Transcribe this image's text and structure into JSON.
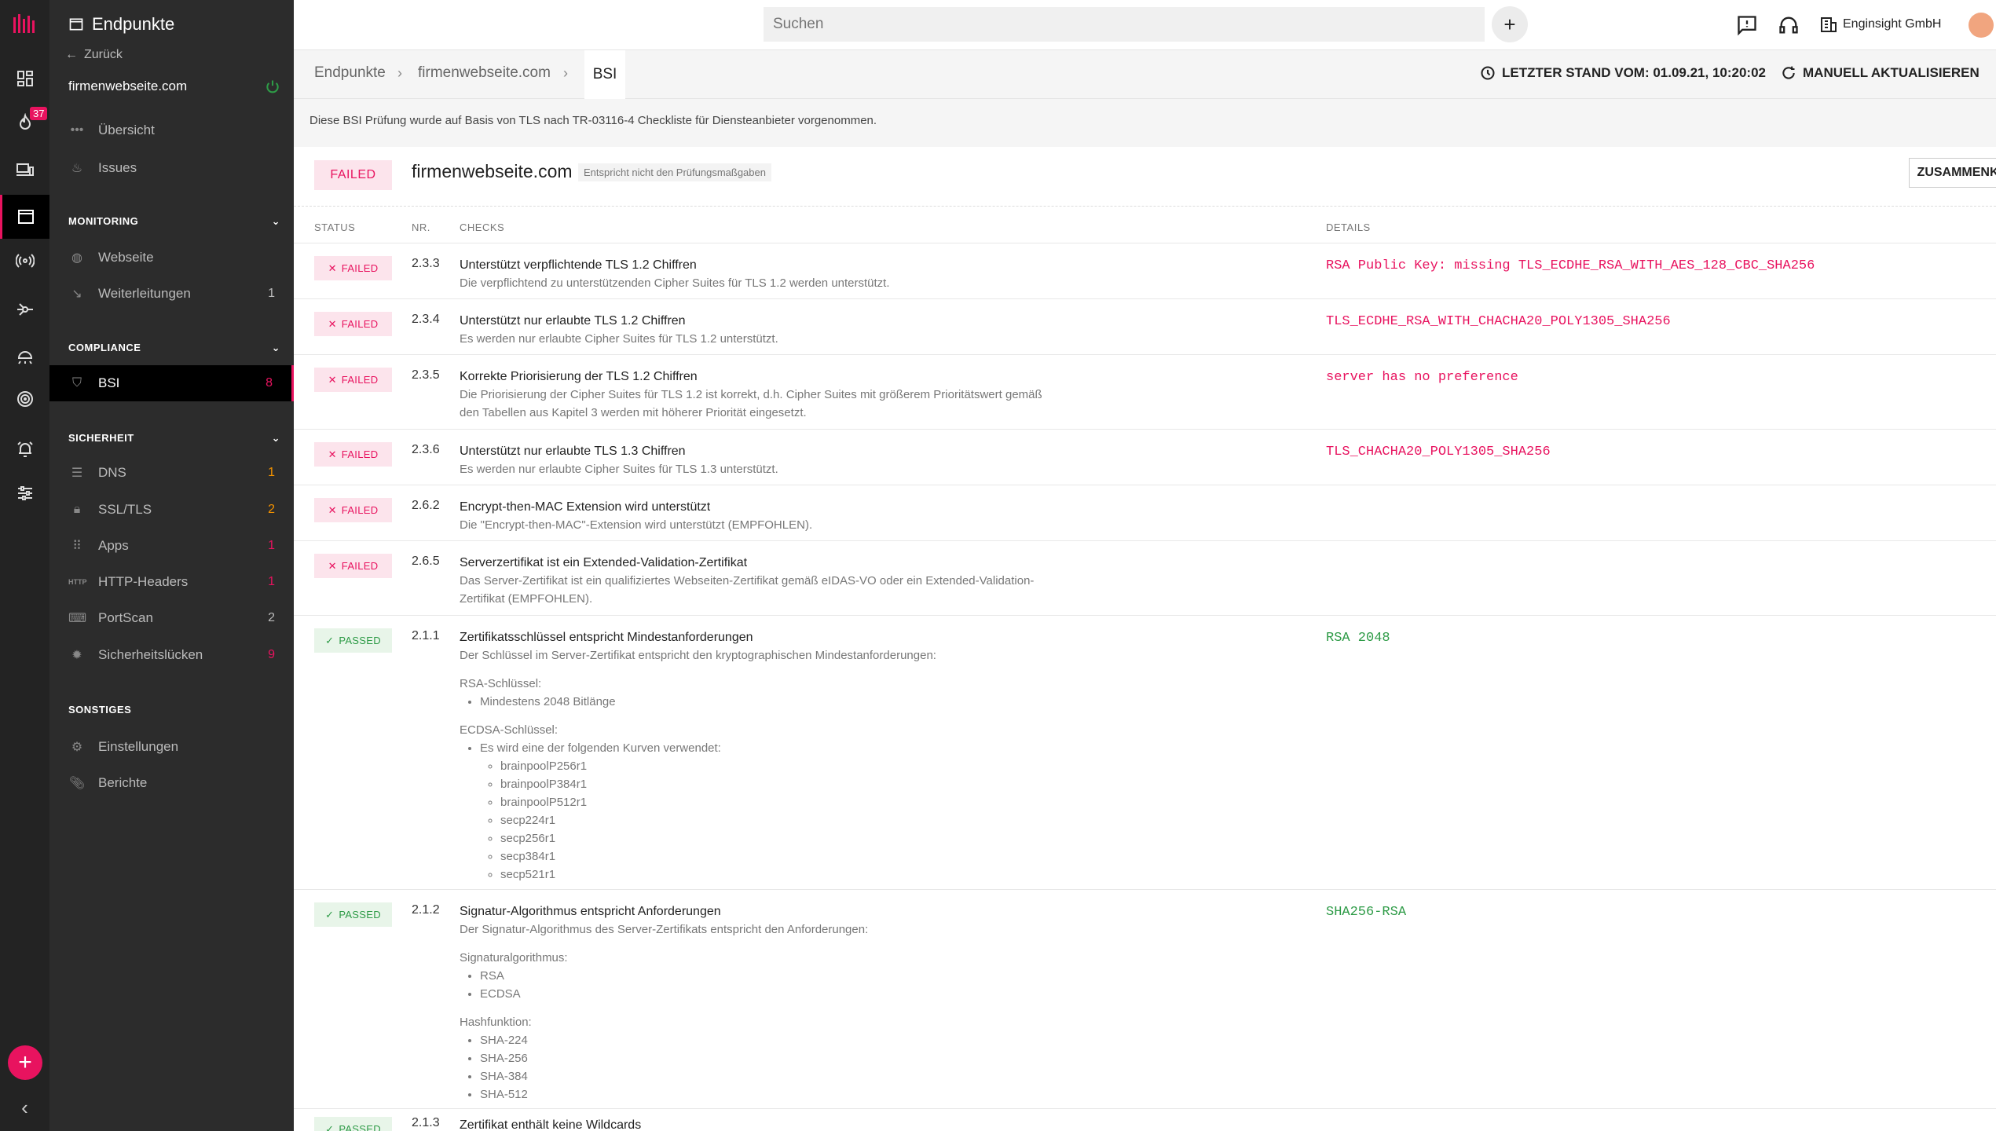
{
  "sidebar": {
    "rail_badge": "37",
    "title": "Endpunkte",
    "back": "Zurück",
    "host": "firmenwebseite.com",
    "nav_top": [
      {
        "label": "Übersicht",
        "icon": "dots-icon"
      },
      {
        "label": "Issues",
        "icon": "fire-icon"
      }
    ],
    "sec_monitoring": "MONITORING",
    "monitoring": [
      {
        "label": "Webseite",
        "count": "",
        "icon": "globe-icon"
      },
      {
        "label": "Weiterleitungen",
        "count": "1",
        "icon": "redirect-icon"
      }
    ],
    "sec_compliance": "COMPLIANCE",
    "compliance": [
      {
        "label": "BSI",
        "count": "8",
        "icon": "shield-icon"
      }
    ],
    "sec_sicherheit": "SICHERHEIT",
    "sicherheit": [
      {
        "label": "DNS",
        "count": "1",
        "icon": "dns-icon"
      },
      {
        "label": "SSL/TLS",
        "count": "2",
        "icon": "lock-icon"
      },
      {
        "label": "Apps",
        "count": "1",
        "icon": "grid-icon"
      },
      {
        "label": "HTTP-Headers",
        "count": "1",
        "icon": "http-icon"
      },
      {
        "label": "PortScan",
        "count": "2",
        "icon": "portscan-icon"
      },
      {
        "label": "Sicherheitslücken",
        "count": "9",
        "icon": "bug-icon"
      }
    ],
    "sec_sonstiges": "SONSTIGES",
    "sonstiges": [
      {
        "label": "Einstellungen",
        "icon": "gear-icon"
      },
      {
        "label": "Berichte",
        "icon": "paperclip-icon"
      }
    ]
  },
  "topbar": {
    "search_placeholder": "Suchen",
    "company": "Enginsight GmbH"
  },
  "breadcrumb": {
    "items": [
      "Endpunkte",
      "firmenwebseite.com",
      "BSI"
    ],
    "last_update": "LETZTER STAND VOM: 01.09.21, 10:20:02",
    "refresh": "MANUELL AKTUALISIEREN"
  },
  "info_text": "Diese BSI Prüfung wurde auf Basis von TLS nach TR-03116-4 Checkliste für Diensteanbieter vorgenommen.",
  "result": {
    "status": "FAILED",
    "host": "firmenwebseite.com",
    "subtitle": "Entspricht nicht den Prüfungsmaßgaben",
    "collapse": "ZUSAMMENKLAPPEN"
  },
  "columns": {
    "status": "STATUS",
    "nr": "NR.",
    "checks": "CHECKS",
    "details": "DETAILS"
  },
  "checks": [
    {
      "status": "FAILED",
      "nr": "2.3.3",
      "title": "Unterstützt verpflichtende TLS 1.2 Chiffren",
      "desc": [
        "Die verpflichtend zu unterstützenden Cipher Suites für TLS 1.2 werden unterstützt."
      ],
      "detail": "RSA Public Key: missing TLS_ECDHE_RSA_WITH_AES_128_CBC_SHA256"
    },
    {
      "status": "FAILED",
      "nr": "2.3.4",
      "title": "Unterstützt nur erlaubte TLS 1.2 Chiffren",
      "desc": [
        "Es werden nur erlaubte Cipher Suites für TLS 1.2 unterstützt."
      ],
      "detail": "TLS_ECDHE_RSA_WITH_CHACHA20_POLY1305_SHA256"
    },
    {
      "status": "FAILED",
      "nr": "2.3.5",
      "title": "Korrekte Priorisierung der TLS 1.2 Chiffren",
      "desc": [
        "Die Priorisierung der Cipher Suites für TLS 1.2 ist korrekt, d.h. Cipher Suites mit größerem Prioritätswert gemäß",
        "den Tabellen aus Kapitel 3 werden mit höherer Priorität eingesetzt."
      ],
      "detail": "server has no preference"
    },
    {
      "status": "FAILED",
      "nr": "2.3.6",
      "title": "Unterstützt nur erlaubte TLS 1.3 Chiffren",
      "desc": [
        "Es werden nur erlaubte Cipher Suites für TLS 1.3 unterstützt."
      ],
      "detail": "TLS_CHACHA20_POLY1305_SHA256"
    },
    {
      "status": "FAILED",
      "nr": "2.6.2",
      "title": "Encrypt-then-MAC Extension wird unterstützt",
      "desc": [
        "Die \"Encrypt-then-MAC\"-Extension wird unterstützt (EMPFOHLEN)."
      ],
      "detail": ""
    },
    {
      "status": "FAILED",
      "nr": "2.6.5",
      "title": "Serverzertifikat ist ein Extended-Validation-Zertifikat",
      "desc": [
        "Das Server-Zertifikat ist ein qualifiziertes Webseiten-Zertifikat gemäß eIDAS-VO oder ein Extended-Validation-",
        "Zertifikat (EMPFOHLEN)."
      ],
      "detail": ""
    },
    {
      "status": "PASSED",
      "nr": "2.1.1",
      "title": "Zertifikatsschlüssel entspricht Mindestanforderungen",
      "desc": [
        "Der Schlüssel im Server-Zertifikat entspricht den kryptographischen Mindestanforderungen:"
      ],
      "rsa_label": "RSA-Schlüssel:",
      "rsa_items": [
        "Mindestens 2048 Bitlänge"
      ],
      "ecdsa_label": "ECDSA-Schlüssel:",
      "ecdsa_item": "Es wird eine der folgenden Kurven verwendet:",
      "curves": [
        "brainpoolP256r1",
        "brainpoolP384r1",
        "brainpoolP512r1",
        "secp224r1",
        "secp256r1",
        "secp384r1",
        "secp521r1"
      ],
      "detail": "RSA 2048"
    },
    {
      "status": "PASSED",
      "nr": "2.1.2",
      "title": "Signatur-Algorithmus entspricht Anforderungen",
      "desc": [
        "Der Signatur-Algorithmus des Server-Zertifikats entspricht den Anforderungen:"
      ],
      "sig_label": "Signaturalgorithmus:",
      "sig_items": [
        "RSA",
        "ECDSA"
      ],
      "hash_label": "Hashfunktion:",
      "hash_items": [
        "SHA-224",
        "SHA-256",
        "SHA-384",
        "SHA-512"
      ],
      "detail": "SHA256-RSA"
    },
    {
      "status": "PASSED",
      "nr": "2.1.3",
      "title": "Zertifikat enthält keine Wildcards",
      "desc": [],
      "detail": ""
    }
  ]
}
